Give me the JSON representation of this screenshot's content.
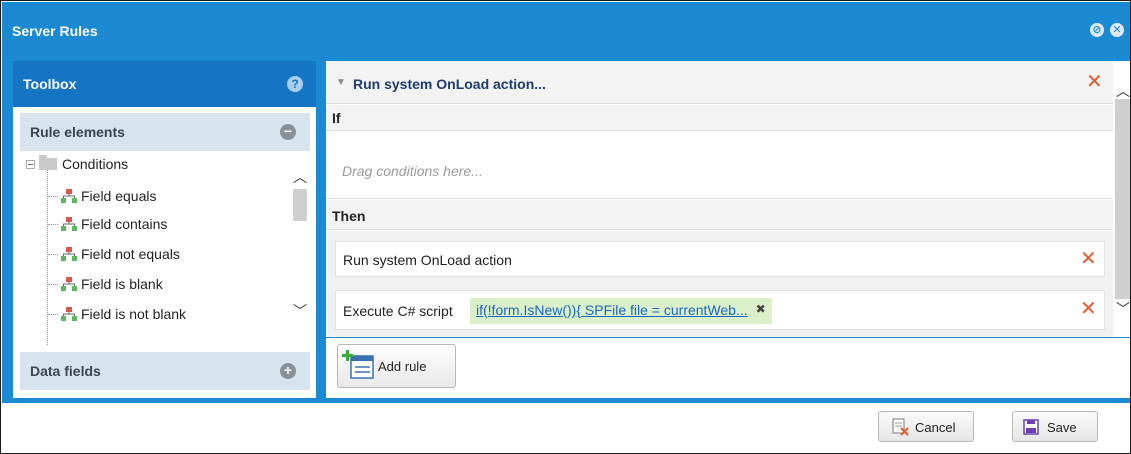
{
  "window": {
    "title": "Server Rules"
  },
  "toolbox": {
    "title": "Toolbox",
    "help_icon": "?",
    "rule_elements": {
      "title": "Rule elements",
      "toggle": "−",
      "folder": "Conditions",
      "items": [
        "Field equals",
        "Field contains",
        "Field not equals",
        "Field is blank",
        "Field is not blank"
      ]
    },
    "data_fields": {
      "title": "Data fields",
      "toggle": "+"
    }
  },
  "rule": {
    "title": "Run system OnLoad action...",
    "if_label": "If",
    "drop_placeholder": "Drag conditions here...",
    "then_label": "Then",
    "actions": [
      {
        "label": "Run system OnLoad action"
      },
      {
        "label": "Execute C# script",
        "script": "if(!form.IsNew()){ SPFile file = currentWeb..."
      }
    ],
    "add_rule_label": "Add rule"
  },
  "footer": {
    "cancel_label": "Cancel",
    "save_label": "Save"
  },
  "colors": {
    "title_bar": "#1c8ad3",
    "toolbox_header": "#1575c4",
    "delete_x": "#e35b2a",
    "script_chip": "#d9f0c8"
  }
}
